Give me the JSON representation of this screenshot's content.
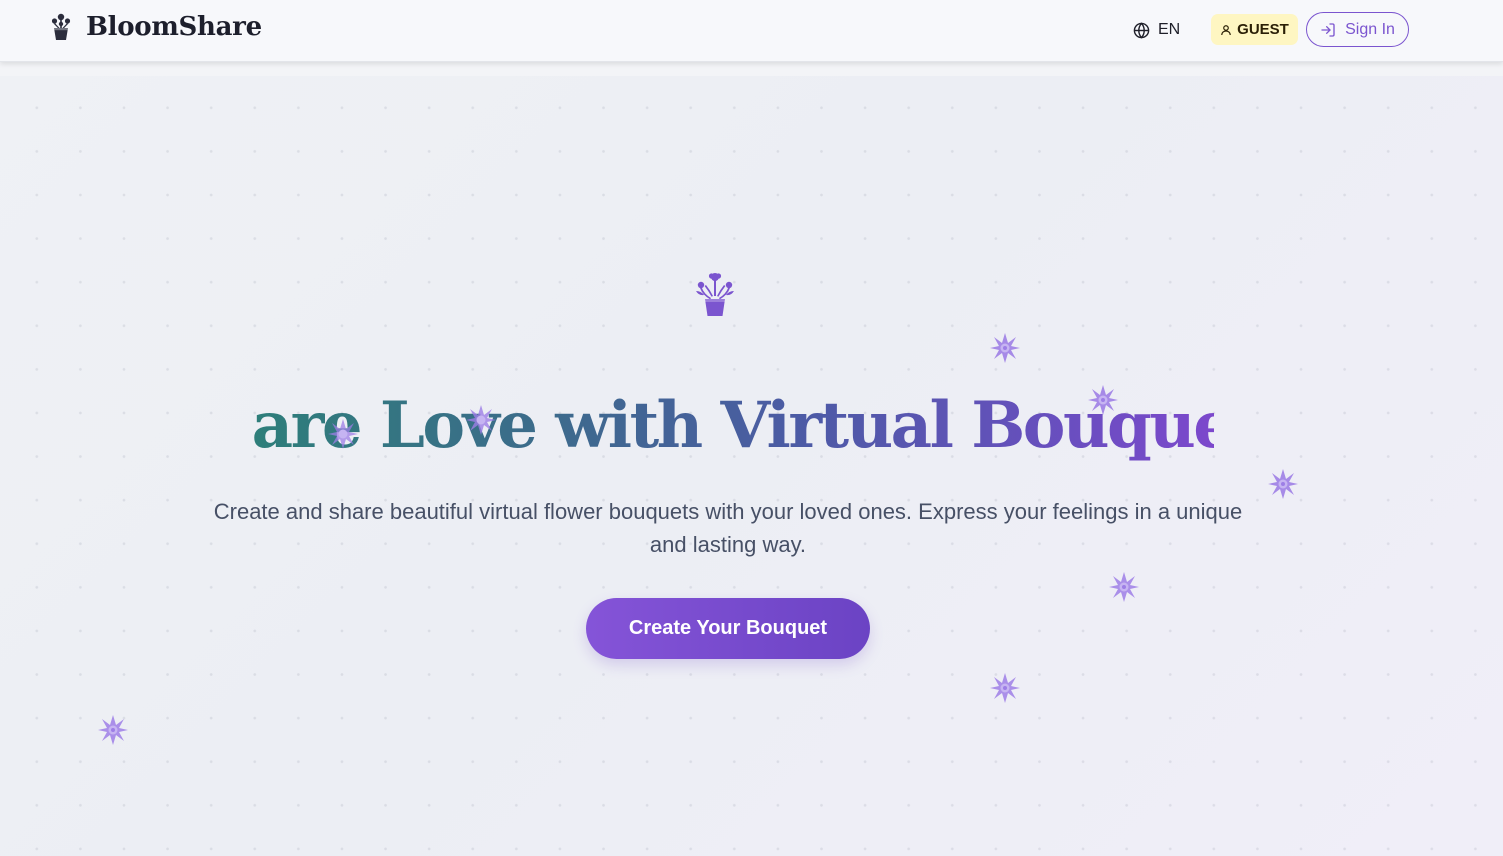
{
  "header": {
    "brand_name": "BloomShare",
    "brand_icon": "potted-flowers-icon",
    "language_label": "EN",
    "language_icon": "globe-icon",
    "guest_label": "GUEST",
    "guest_icon": "user-icon",
    "signin_label": "Sign In",
    "signin_icon": "sign-in-icon"
  },
  "hero": {
    "icon": "potted-flowers-icon",
    "headline": "Share Love with Virtual Bouquets",
    "subtext": "Create and share beautiful virtual flower bouquets with your loved ones. Express your feelings in a unique and lasting way.",
    "cta_label": "Create Your Bouquet",
    "decoration_icon": "flower-icon"
  },
  "colors": {
    "accent": "#7b55cf",
    "cta_start": "#8554d8",
    "cta_end": "#6b43c4",
    "guest_badge_bg": "#fef6c2",
    "headline_start": "#2e7e7a",
    "headline_end": "#7c48cc",
    "decor_flower": "#9d7ee6"
  }
}
